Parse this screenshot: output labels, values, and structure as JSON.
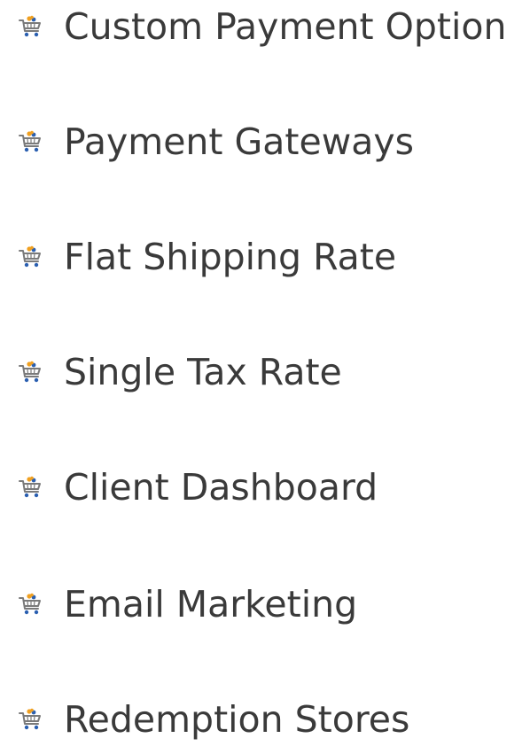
{
  "colors": {
    "text": "#3a3a3a",
    "icon_cart": "#7a7a7a",
    "icon_items": "#f0a020",
    "icon_accent": "#2a5fb0"
  },
  "features": {
    "icon": "shopping-cart-icon",
    "items": [
      {
        "label": "Custom Payment Option"
      },
      {
        "label": "Payment Gateways"
      },
      {
        "label": "Flat Shipping Rate"
      },
      {
        "label": "Single Tax Rate"
      },
      {
        "label": "Client Dashboard"
      },
      {
        "label": "Email Marketing"
      },
      {
        "label": "Redemption Stores"
      }
    ]
  }
}
